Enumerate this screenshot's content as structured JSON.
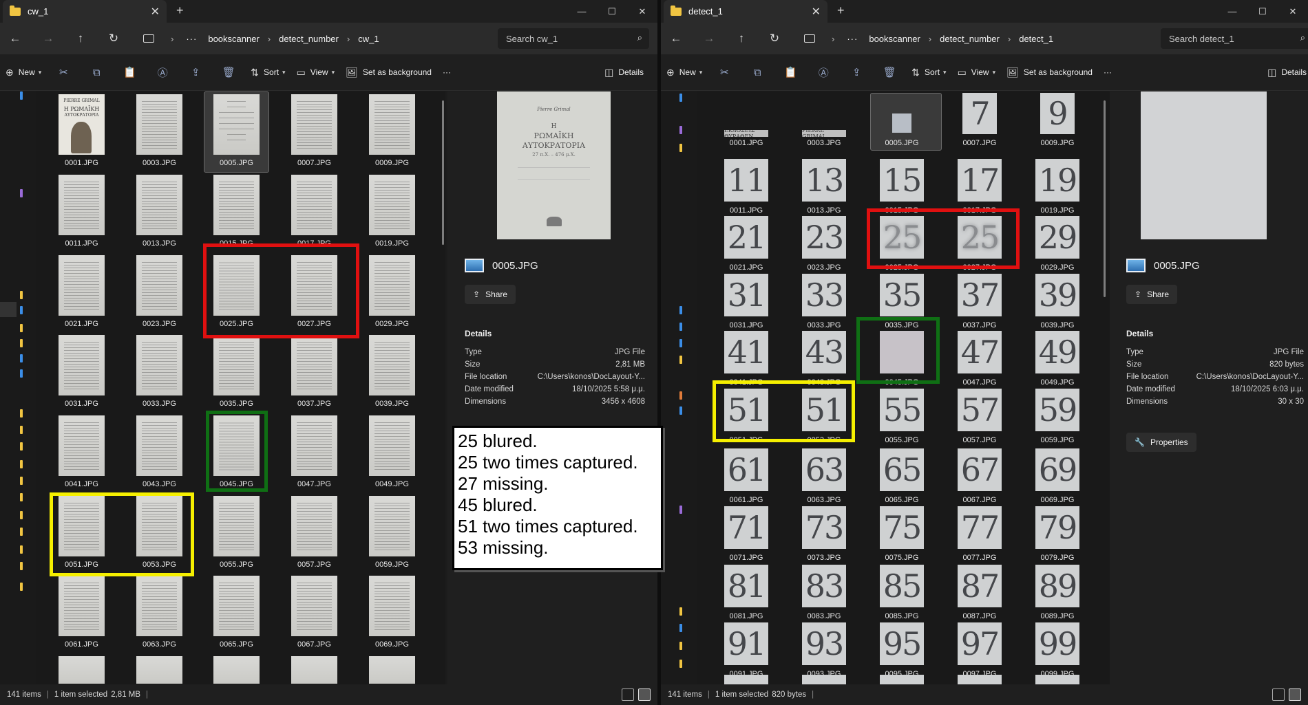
{
  "left": {
    "tab_title": "cw_1",
    "breadcrumbs": [
      "bookscanner",
      "detect_number",
      "cw_1"
    ],
    "search_placeholder": "Search cw_1",
    "commands": {
      "new": "New",
      "sort": "Sort",
      "view": "View",
      "background": "Set as background",
      "details": "Details"
    },
    "files": [
      "0001.JPG",
      "0003.JPG",
      "0005.JPG",
      "0007.JPG",
      "0009.JPG",
      "0011.JPG",
      "0013.JPG",
      "0015.JPG",
      "0017.JPG",
      "0019.JPG",
      "0021.JPG",
      "0023.JPG",
      "0025.JPG",
      "0027.JPG",
      "0029.JPG",
      "0031.JPG",
      "0033.JPG",
      "0035.JPG",
      "0037.JPG",
      "0039.JPG",
      "0041.JPG",
      "0043.JPG",
      "0045.JPG",
      "0047.JPG",
      "0049.JPG",
      "0051.JPG",
      "0053.JPG",
      "0055.JPG",
      "0057.JPG",
      "0059.JPG",
      "0061.JPG",
      "0063.JPG",
      "0065.JPG",
      "0067.JPG",
      "0069.JPG"
    ],
    "selected_file": "0005.JPG",
    "preview": {
      "title_page": {
        "author": "Pierre Grimal",
        "line1": "H",
        "line2": "ΡΩΜΑΪΚΗ",
        "line3": "ΑΥΤΟΚΡΑΤΟΡΙΑ",
        "line4": "27 π.Χ. – 476 μ.Χ."
      },
      "name": "0005.JPG",
      "share": "Share",
      "details_heading": "Details",
      "rows": [
        {
          "key": "Type",
          "value": "JPG File"
        },
        {
          "key": "Size",
          "value": "2,81 MB"
        },
        {
          "key": "File location",
          "value": "C:\\Users\\konos\\DocLayout-Y..."
        },
        {
          "key": "Date modified",
          "value": "18/10/2025 5:58 μ.μ."
        },
        {
          "key": "Dimensions",
          "value": "3456 x 4608"
        }
      ]
    },
    "cover": {
      "top": "PIERRE GRIMAL",
      "mid": "Η ΡΩΜΑΪΚΗ",
      "bottom": "ΑΥΤΟΚΡΑΤΟΡΙΑ"
    },
    "status": {
      "count": "141 items",
      "selection": "1 item selected",
      "size": "2,81 MB"
    }
  },
  "right": {
    "tab_title": "detect_1",
    "breadcrumbs": [
      "bookscanner",
      "detect_number",
      "detect_1"
    ],
    "search_placeholder": "Search detect_1",
    "commands": {
      "new": "New",
      "sort": "Sort",
      "view": "View",
      "background": "Set as background",
      "details": "Details"
    },
    "files": [
      "0001.JPG",
      "0003.JPG",
      "0005.JPG",
      "0007.JPG",
      "0009.JPG",
      "0011.JPG",
      "0013.JPG",
      "0015.JPG",
      "0017.JPG",
      "0019.JPG",
      "0021.JPG",
      "0023.JPG",
      "0025.JPG",
      "0027.JPG",
      "0029.JPG",
      "0031.JPG",
      "0033.JPG",
      "0035.JPG",
      "0037.JPG",
      "0039.JPG",
      "0041.JPG",
      "0043.JPG",
      "0045.JPG",
      "0047.JPG",
      "0049.JPG",
      "0051.JPG",
      "0053.JPG",
      "0055.JPG",
      "0057.JPG",
      "0059.JPG",
      "0061.JPG",
      "0063.JPG",
      "0065.JPG",
      "0067.JPG",
      "0069.JPG",
      "0071.JPG",
      "0073.JPG",
      "0075.JPG",
      "0077.JPG",
      "0079.JPG",
      "0081.JPG",
      "0083.JPG",
      "0085.JPG",
      "0087.JPG",
      "0089.JPG",
      "0091.JPG",
      "0093.JPG",
      "0095.JPG",
      "0097.JPG",
      "0099.JPG"
    ],
    "thumb_text": [
      "ΕΚΔΟΣΕΙΣ ΘΥΡΑΘΕΝ",
      "PIERRE GRIMAL",
      "",
      "7",
      "9",
      "11",
      "13",
      "15",
      "17",
      "19",
      "21",
      "23",
      "25",
      "25",
      "29",
      "31",
      "33",
      "35",
      "37",
      "39",
      "41",
      "43",
      "",
      "47",
      "49",
      "51",
      "51",
      "55",
      "57",
      "59",
      "61",
      "63",
      "65",
      "67",
      "69",
      "71",
      "73",
      "75",
      "77",
      "79",
      "81",
      "83",
      "85",
      "87",
      "89",
      "91",
      "93",
      "95",
      "97",
      "99"
    ],
    "selected_file": "0005.JPG",
    "preview": {
      "name": "0005.JPG",
      "share": "Share",
      "details_heading": "Details",
      "properties": "Properties",
      "rows": [
        {
          "key": "Type",
          "value": "JPG File"
        },
        {
          "key": "Size",
          "value": "820 bytes"
        },
        {
          "key": "File location",
          "value": "C:\\Users\\konos\\DocLayout-Y..."
        },
        {
          "key": "Date modified",
          "value": "18/10/2025 6:03 μ.μ."
        },
        {
          "key": "Dimensions",
          "value": "30 x 30"
        }
      ]
    },
    "status": {
      "count": "141 items",
      "selection": "1 item selected",
      "size": "820 bytes"
    }
  },
  "note_lines": [
    "25 blured.",
    "25 two times captured.",
    "27 missing.",
    "45 blured.",
    "51 two times captured.",
    "53 missing."
  ],
  "colors": {
    "red": "#e01010",
    "green": "#0f6f14",
    "yellow": "#f5ef00"
  }
}
